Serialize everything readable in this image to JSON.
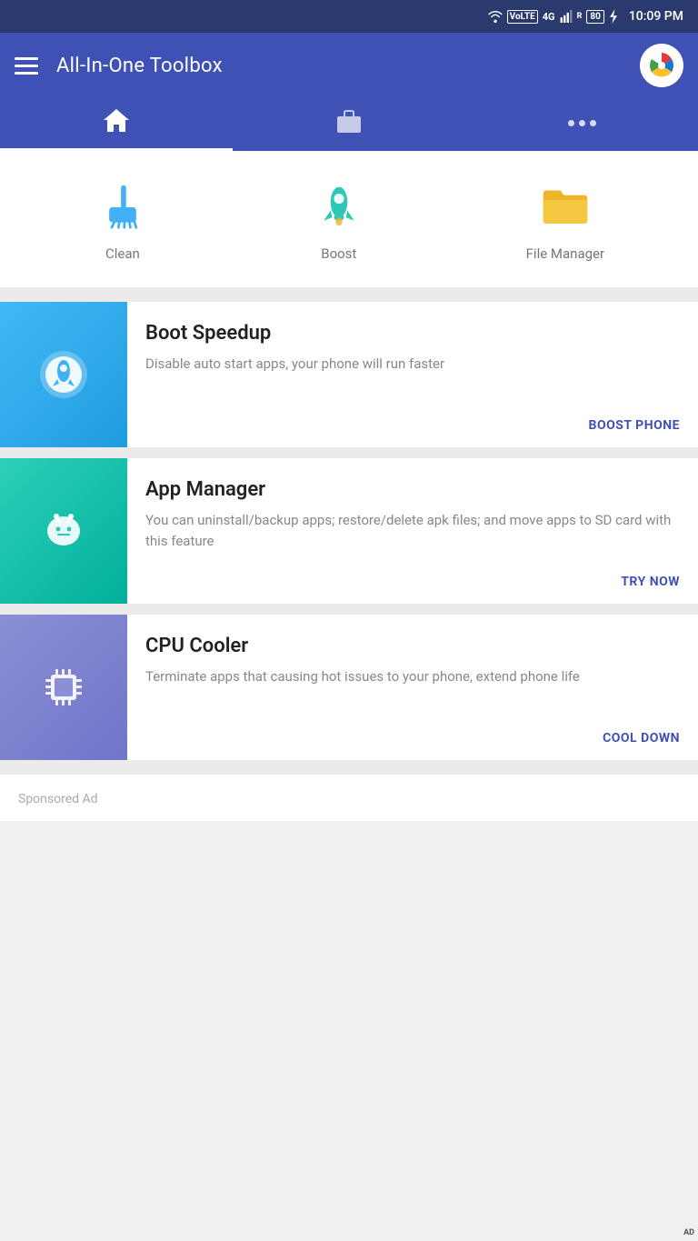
{
  "statusBar": {
    "time": "10:09 PM",
    "icons": [
      "wifi",
      "volte",
      "4g",
      "signal",
      "battery80",
      "flash"
    ]
  },
  "appBar": {
    "title": "All-In-One Toolbox",
    "menuIcon": "hamburger-icon",
    "adIcon": "ad-icon"
  },
  "tabs": [
    {
      "id": "home",
      "label": "Home",
      "icon": "home-icon",
      "active": true
    },
    {
      "id": "briefcase",
      "label": "Briefcase",
      "icon": "briefcase-icon",
      "active": false
    },
    {
      "id": "more",
      "label": "More",
      "icon": "more-icon",
      "active": false
    }
  ],
  "features": [
    {
      "id": "clean",
      "label": "Clean",
      "icon": "broom-icon",
      "color": "#42b0f5"
    },
    {
      "id": "boost",
      "label": "Boost",
      "icon": "rocket-icon",
      "color": "#2ec8b8"
    },
    {
      "id": "file-manager",
      "label": "File Manager",
      "icon": "folder-icon",
      "color": "#f0b429"
    }
  ],
  "cards": [
    {
      "id": "boot-speedup",
      "title": "Boot Speedup",
      "description": "Disable auto start apps, your phone will run faster",
      "actionLabel": "BOOST PHONE",
      "iconColor": "blue",
      "iconType": "rocket-white"
    },
    {
      "id": "app-manager",
      "title": "App Manager",
      "description": "You can uninstall/backup apps; restore/delete apk files; and move apps to SD card with this feature",
      "actionLabel": "TRY NOW",
      "iconColor": "teal",
      "iconType": "android-white"
    },
    {
      "id": "cpu-cooler",
      "title": "CPU Cooler",
      "description": "Terminate apps that causing hot issues to your phone, extend phone life",
      "actionLabel": "COOL DOWN",
      "iconColor": "purple",
      "iconType": "cpu-white"
    }
  ],
  "sponsoredAd": {
    "label": "Sponsored Ad"
  }
}
